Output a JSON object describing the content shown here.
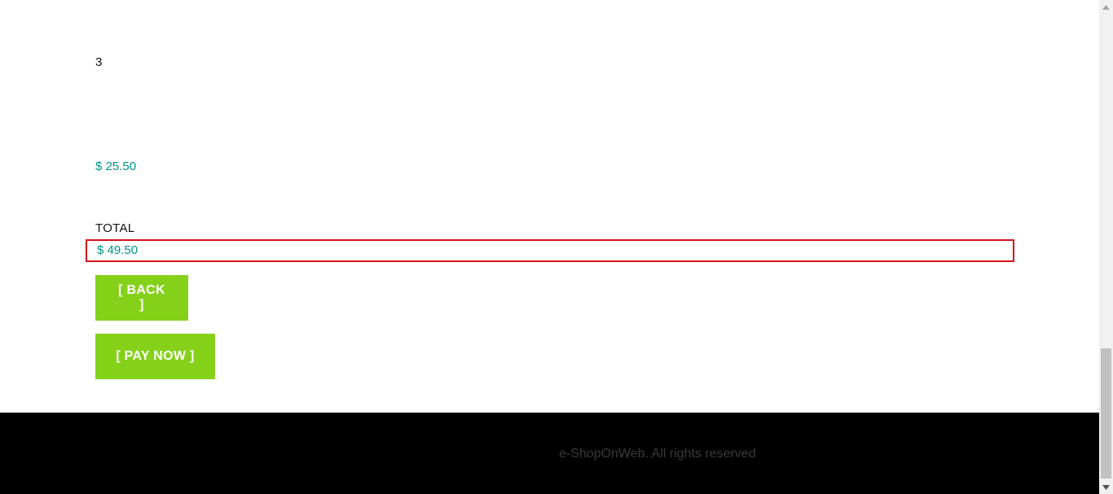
{
  "basket": {
    "quantity": "3",
    "line_price": "$ 25.50",
    "total_label": "TOTAL",
    "total_value": "$ 49.50"
  },
  "actions": {
    "back_label": "[ BACK ]",
    "pay_label": "[ PAY NOW ]"
  },
  "footer": {
    "copyright": "e-ShopOnWeb. All rights reserved"
  },
  "colors": {
    "accent_green": "#85d11a",
    "price_teal": "#00938a",
    "highlight_red": "#d0121b",
    "footer_bg": "#000000"
  },
  "scrollbar": {
    "up_icon": "triangle-up-icon",
    "down_icon": "triangle-down-icon"
  }
}
